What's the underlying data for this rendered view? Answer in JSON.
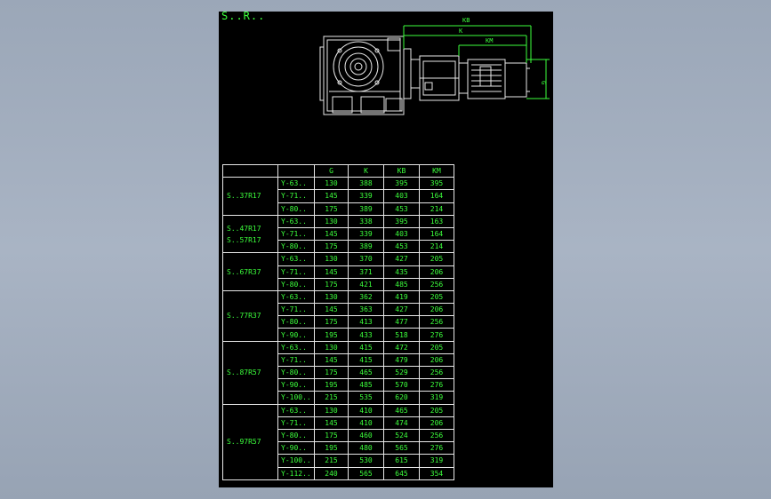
{
  "drawing": {
    "title": "S..R..",
    "dims": {
      "kb": "KB",
      "k": "K",
      "km": "KM",
      "g": "G"
    }
  },
  "table": {
    "headers": [
      "",
      "",
      "G",
      "K",
      "KB",
      "KM"
    ],
    "groups": [
      {
        "model": [
          "S..37R17"
        ],
        "rows": [
          [
            "Y-63..",
            "130",
            "388",
            "395",
            "395"
          ],
          [
            "Y-71..",
            "145",
            "339",
            "403",
            "164"
          ],
          [
            "Y-80..",
            "175",
            "389",
            "453",
            "214"
          ]
        ]
      },
      {
        "model": [
          "S..47R17",
          "S..57R17"
        ],
        "rows": [
          [
            "Y-63..",
            "130",
            "338",
            "395",
            "163"
          ],
          [
            "Y-71..",
            "145",
            "339",
            "403",
            "164"
          ],
          [
            "Y-80..",
            "175",
            "389",
            "453",
            "214"
          ]
        ]
      },
      {
        "model": [
          "S..67R37"
        ],
        "rows": [
          [
            "Y-63..",
            "130",
            "370",
            "427",
            "205"
          ],
          [
            "Y-71..",
            "145",
            "371",
            "435",
            "206"
          ],
          [
            "Y-80..",
            "175",
            "421",
            "485",
            "256"
          ]
        ]
      },
      {
        "model": [
          "S..77R37"
        ],
        "rows": [
          [
            "Y-63..",
            "130",
            "362",
            "419",
            "205"
          ],
          [
            "Y-71..",
            "145",
            "363",
            "427",
            "206"
          ],
          [
            "Y-80..",
            "175",
            "413",
            "477",
            "256"
          ],
          [
            "Y-90..",
            "195",
            "433",
            "518",
            "276"
          ]
        ]
      },
      {
        "model": [
          "S..87R57"
        ],
        "rows": [
          [
            "Y-63..",
            "130",
            "415",
            "472",
            "205"
          ],
          [
            "Y-71..",
            "145",
            "415",
            "479",
            "206"
          ],
          [
            "Y-80..",
            "175",
            "465",
            "529",
            "256"
          ],
          [
            "Y-90..",
            "195",
            "485",
            "570",
            "276"
          ],
          [
            "Y-100..",
            "215",
            "535",
            "620",
            "319"
          ]
        ]
      },
      {
        "model": [
          "S..97R57"
        ],
        "rows": [
          [
            "Y-63..",
            "130",
            "410",
            "465",
            "205"
          ],
          [
            "Y-71..",
            "145",
            "410",
            "474",
            "206"
          ],
          [
            "Y-80..",
            "175",
            "460",
            "524",
            "256"
          ],
          [
            "Y-90..",
            "195",
            "480",
            "565",
            "276"
          ],
          [
            "Y-100..",
            "215",
            "530",
            "615",
            "319"
          ],
          [
            "Y-112..",
            "240",
            "565",
            "645",
            "354"
          ]
        ]
      }
    ]
  }
}
